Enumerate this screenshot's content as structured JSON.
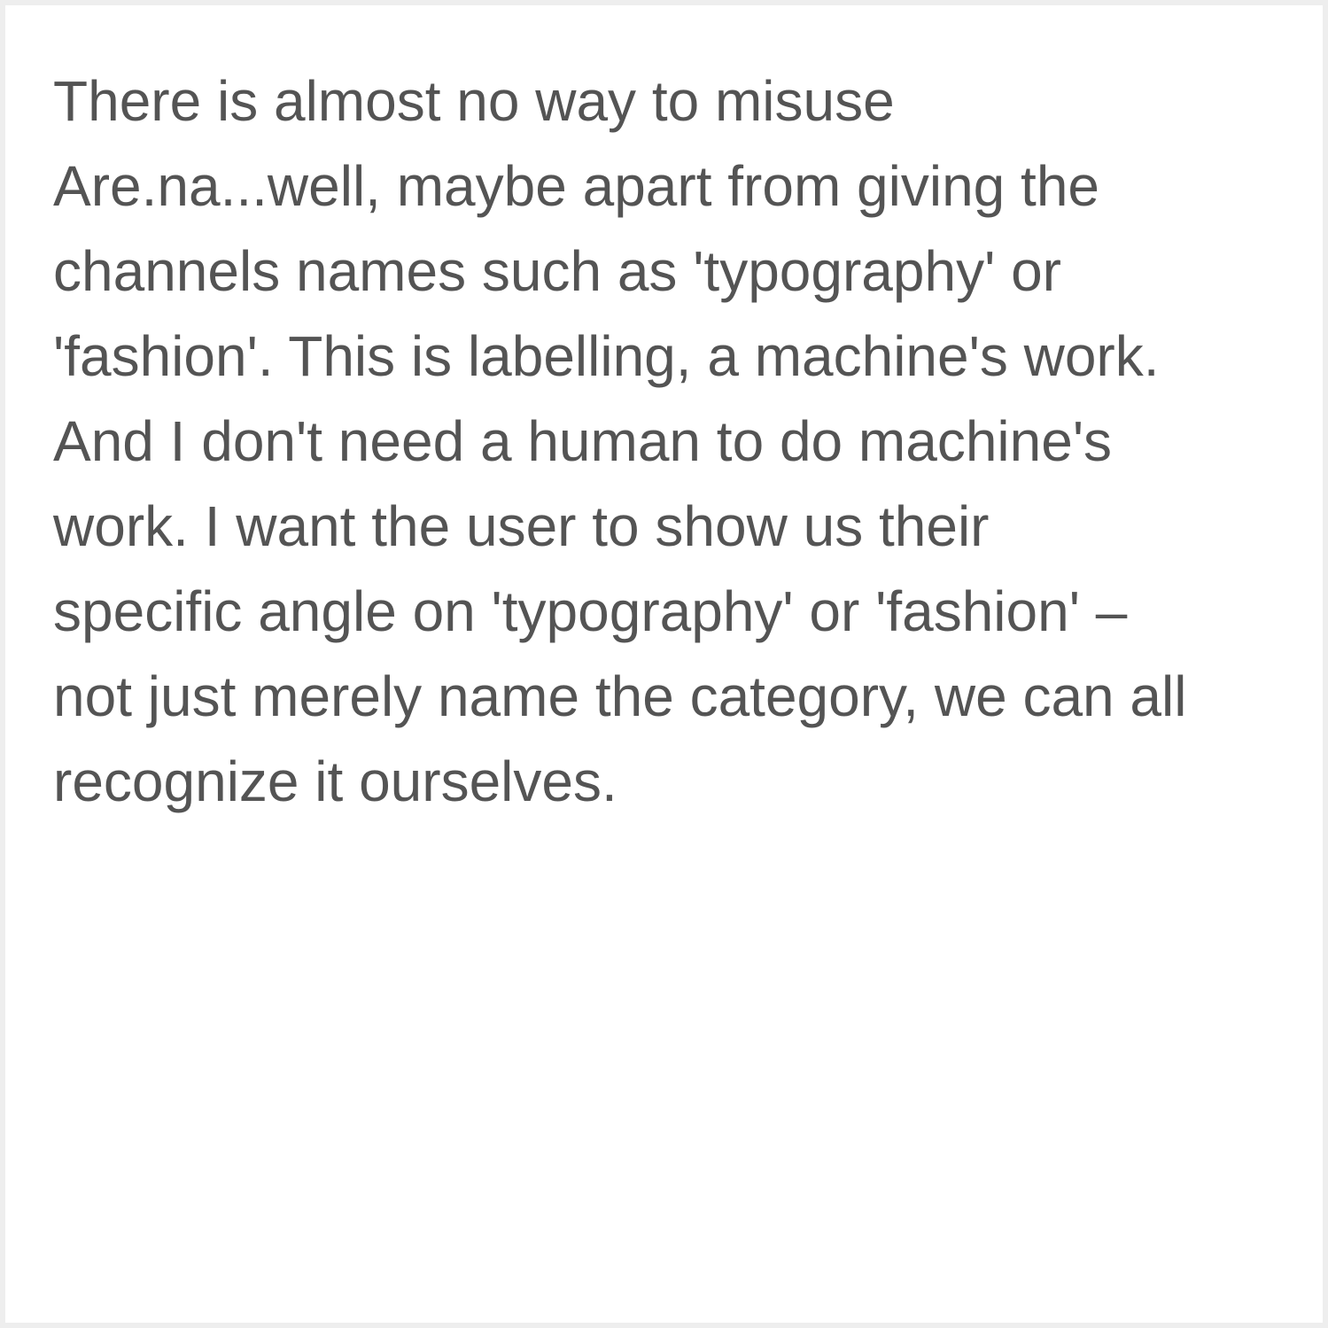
{
  "block": {
    "lines": [
      "There is almost no way to misuse",
      "Are.na...well, maybe apart from giving the",
      "channels names such as 'typography' or",
      "'fashion'. This is labelling, a machine's work.",
      "And I don't need a human to do machine's",
      "work. I want the user to show us their",
      "specific angle on 'typography' or 'fashion' –",
      "not just merely name the category, we can all",
      "recognize it ourselves."
    ],
    "text_color": "#545454",
    "background_color": "#ffffff",
    "border_color": "#eeeeee"
  }
}
